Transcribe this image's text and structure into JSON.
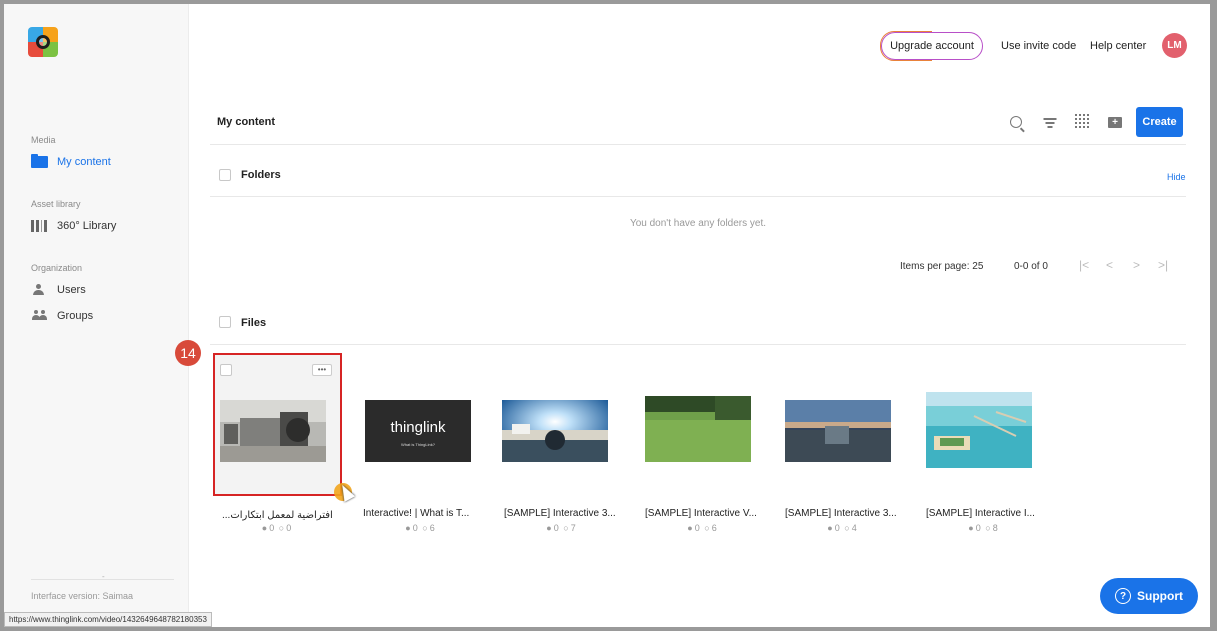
{
  "app": {
    "name": "ThingLink",
    "colors": {
      "accent": "#1a73e8",
      "avatar": "#e2606d",
      "badge": "#d84a3a",
      "highlight_border": "#d62424"
    }
  },
  "header": {
    "upgrade_label": "Upgrade account",
    "invite_label": "Use invite code",
    "help_label": "Help center",
    "avatar_initials": "LM"
  },
  "sidebar": {
    "media_title": "Media",
    "my_content": "My content",
    "asset_title": "Asset library",
    "library": "360° Library",
    "org_title": "Organization",
    "users": "Users",
    "groups": "Groups",
    "interface_version": "Interface version: Saimaa"
  },
  "content": {
    "title": "My content",
    "create_label": "Create",
    "folders_label": "Folders",
    "hide_label": "Hide",
    "empty_folders": "You don't have any folders yet.",
    "items_per_page": "Items per page: 25",
    "range": "0-0 of 0",
    "files_label": "Files"
  },
  "files": [
    {
      "name": "افتراضية لمعمل ابتكارات...",
      "views": "0",
      "likes": "0"
    },
    {
      "name": "Interactive! | What is T...",
      "views": "0",
      "likes": "6"
    },
    {
      "name": "[SAMPLE] Interactive 3...",
      "views": "0",
      "likes": "7"
    },
    {
      "name": "[SAMPLE] Interactive V...",
      "views": "0",
      "likes": "6"
    },
    {
      "name": "[SAMPLE] Interactive 3...",
      "views": "0",
      "likes": "4"
    },
    {
      "name": "[SAMPLE] Interactive I...",
      "views": "0",
      "likes": "8"
    }
  ],
  "thumb2_text": {
    "brand": "thinglink",
    "sub": "What is ThingLink?"
  },
  "step_badge": "14",
  "card_menu": "•••",
  "status_url": "https://www.thinglink.com/video/1432649648782180353",
  "support_label": "Support",
  "support_icon": "?",
  "dash": "-"
}
